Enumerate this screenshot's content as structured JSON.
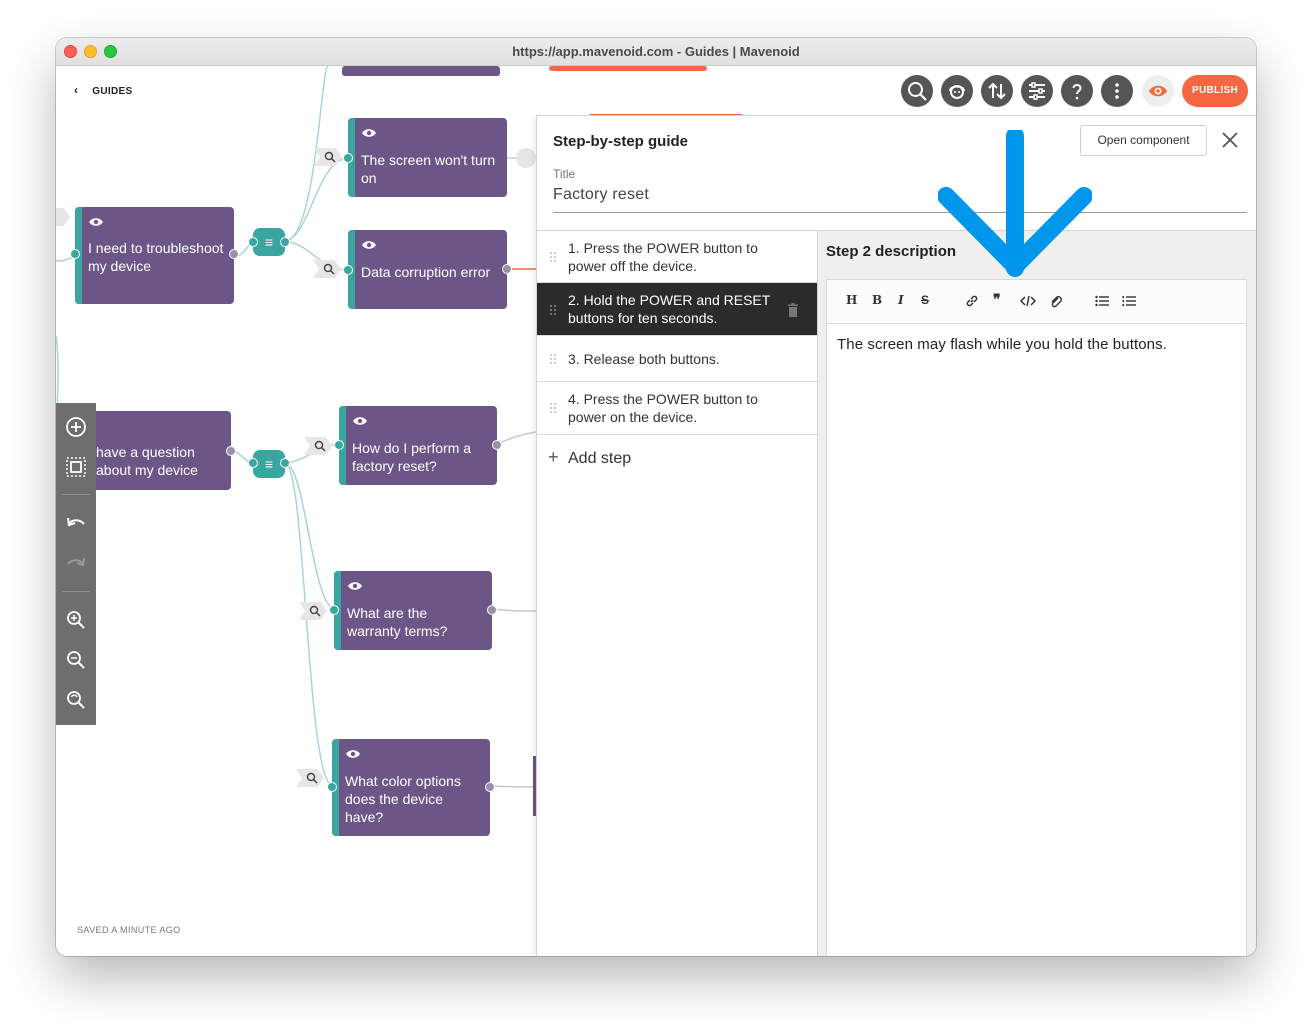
{
  "window": {
    "title": "https://app.mavenoid.com - Guides | Mavenoid"
  },
  "nav": {
    "back_label": "GUIDES"
  },
  "status": {
    "saved": "SAVED A MINUTE AGO"
  },
  "toolbar": {
    "publish_label": "PUBLISH",
    "buttons": [
      "search-icon",
      "agent-icon",
      "sort-icon",
      "settings-sliders-icon",
      "help-icon",
      "more-icon",
      "preview-eye-icon"
    ]
  },
  "nodes": {
    "troubleshoot": "I need to troubleshoot my device",
    "question": "have a question about my device",
    "screen": "The screen won't turn on",
    "corruption": "Data corruption error",
    "factory": "How do I perform a factory reset?",
    "warranty": "What are the warranty terms?",
    "colors": "What color options does the device have?"
  },
  "panel": {
    "title": "Step-by-step guide",
    "open_component": "Open component",
    "title_label": "Title",
    "title_value": "Factory reset",
    "steps": [
      {
        "text": "1. Press the POWER button to power off the device.",
        "active": false
      },
      {
        "text": "2. Hold the POWER and RESET buttons for ten seconds.",
        "active": true
      },
      {
        "text": "3. Release both buttons.",
        "active": false
      },
      {
        "text": "4. Press the POWER button to power on the device.",
        "active": false
      }
    ],
    "add_step": "Add step",
    "description_title": "Step 2 description",
    "description_text": "The screen may flash while you hold the buttons.",
    "editor_tools": [
      "H",
      "B",
      "I",
      "S",
      "link",
      "quote",
      "code",
      "attach",
      "bullet-list",
      "numbered-list"
    ]
  },
  "colors": {
    "node": "#6b5687",
    "accent_teal": "#3aa6a0",
    "publish": "#f36743",
    "arrow": "#0096ec"
  }
}
